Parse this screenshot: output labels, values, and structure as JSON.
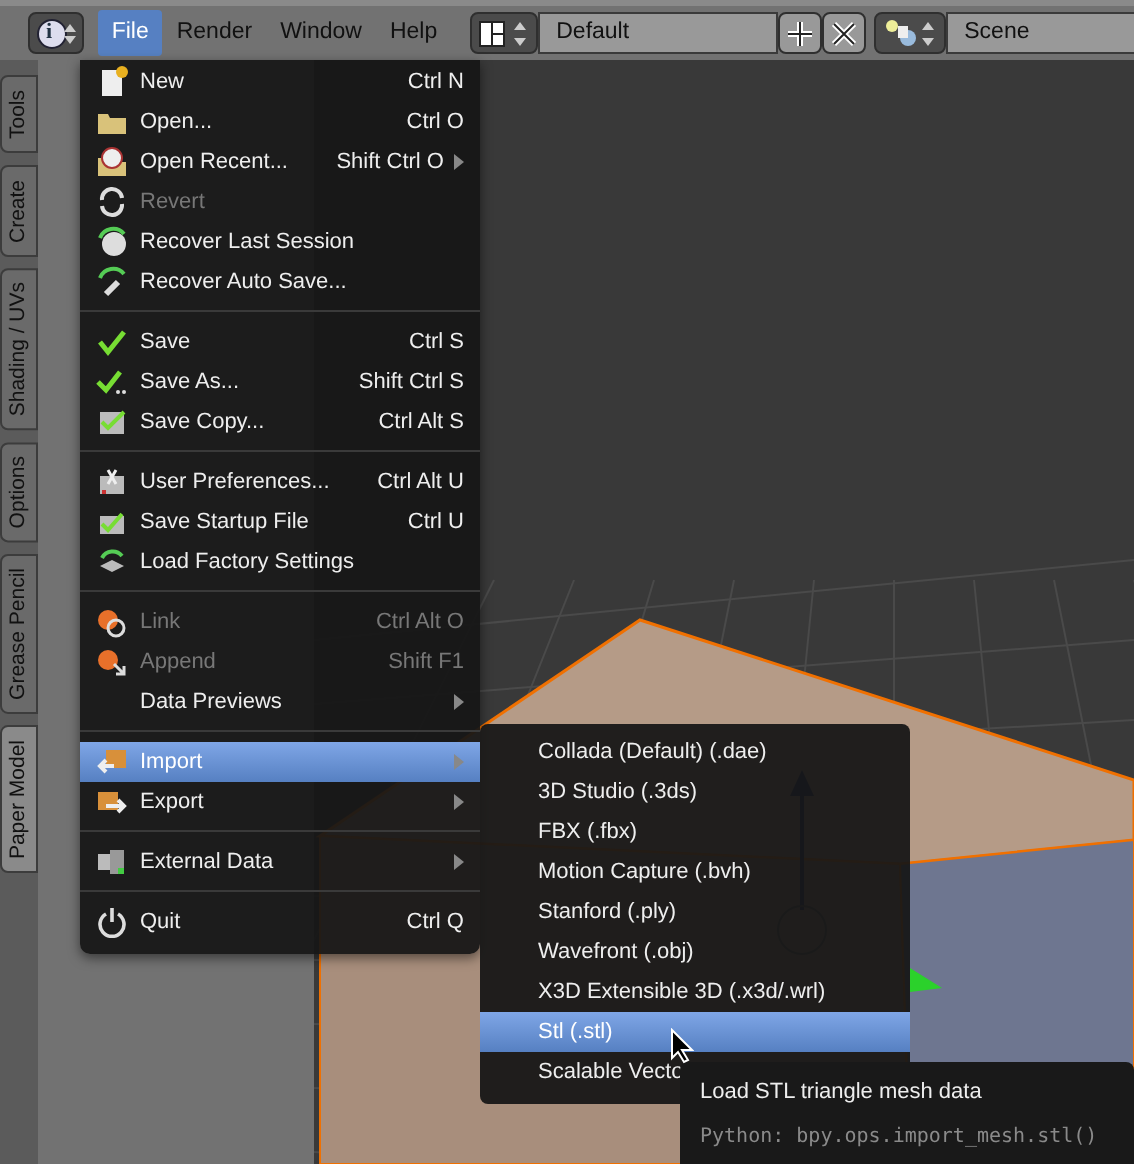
{
  "header": {
    "editor_button": "i",
    "menus": [
      {
        "label": "File",
        "selected": true
      },
      {
        "label": "Render",
        "selected": false
      },
      {
        "label": "Window",
        "selected": false
      },
      {
        "label": "Help",
        "selected": false
      }
    ],
    "layout": "Default",
    "scene": "Scene"
  },
  "tool_tabs": [
    {
      "label": "Tools",
      "selected": false
    },
    {
      "label": "Create",
      "selected": false
    },
    {
      "label": "Shading / UVs",
      "selected": false
    },
    {
      "label": "Options",
      "selected": false
    },
    {
      "label": "Grease Pencil",
      "selected": false
    },
    {
      "label": "Paper Model",
      "selected": true
    }
  ],
  "file_menu": {
    "sections": [
      [
        {
          "label": "New",
          "shortcut": "Ctrl N",
          "disabled": false,
          "submenu": false,
          "selected": false
        },
        {
          "label": "Open...",
          "shortcut": "Ctrl O",
          "disabled": false,
          "submenu": false,
          "selected": false
        },
        {
          "label": "Open Recent...",
          "shortcut": "Shift Ctrl O",
          "disabled": false,
          "submenu": true,
          "selected": false
        },
        {
          "label": "Revert",
          "disabled": true,
          "submenu": false,
          "selected": false
        },
        {
          "label": "Recover Last Session",
          "disabled": false,
          "submenu": false,
          "selected": false
        },
        {
          "label": "Recover Auto Save...",
          "disabled": false,
          "submenu": false,
          "selected": false
        }
      ],
      [
        {
          "label": "Save",
          "shortcut": "Ctrl S",
          "disabled": false,
          "submenu": false,
          "selected": false
        },
        {
          "label": "Save As...",
          "shortcut": "Shift Ctrl S",
          "disabled": false,
          "submenu": false,
          "selected": false
        },
        {
          "label": "Save Copy...",
          "shortcut": "Ctrl Alt S",
          "disabled": false,
          "submenu": false,
          "selected": false
        }
      ],
      [
        {
          "label": "User Preferences...",
          "shortcut": "Ctrl Alt U",
          "disabled": false,
          "submenu": false,
          "selected": false
        },
        {
          "label": "Save Startup File",
          "shortcut": "Ctrl U",
          "disabled": false,
          "submenu": false,
          "selected": false
        },
        {
          "label": "Load Factory Settings",
          "disabled": false,
          "submenu": false,
          "selected": false
        }
      ],
      [
        {
          "label": "Link",
          "shortcut": "Ctrl Alt O",
          "disabled": true,
          "submenu": false,
          "selected": false
        },
        {
          "label": "Append",
          "shortcut": "Shift F1",
          "disabled": true,
          "submenu": false,
          "selected": false
        },
        {
          "label": "Data Previews",
          "disabled": false,
          "submenu": true,
          "selected": false
        }
      ],
      [
        {
          "label": "Import",
          "disabled": false,
          "submenu": true,
          "selected": true
        },
        {
          "label": "Export",
          "disabled": false,
          "submenu": true,
          "selected": false
        }
      ],
      [
        {
          "label": "External Data",
          "disabled": false,
          "submenu": true,
          "selected": false
        }
      ],
      [
        {
          "label": "Quit",
          "shortcut": "Ctrl Q",
          "disabled": false,
          "submenu": false,
          "selected": false
        }
      ]
    ]
  },
  "import_menu": {
    "items": [
      {
        "label": "Collada (Default) (.dae)",
        "selected": false
      },
      {
        "label": "3D Studio (.3ds)",
        "selected": false
      },
      {
        "label": "FBX (.fbx)",
        "selected": false
      },
      {
        "label": "Motion Capture (.bvh)",
        "selected": false
      },
      {
        "label": "Stanford (.ply)",
        "selected": false
      },
      {
        "label": "Wavefront (.obj)",
        "selected": false
      },
      {
        "label": "X3D Extensible 3D (.x3d/.wrl)",
        "selected": false
      },
      {
        "label": "Stl (.stl)",
        "selected": true
      },
      {
        "label": "Scalable Vecto",
        "selected": false
      }
    ]
  },
  "tooltip": {
    "title": "Load STL triangle mesh data",
    "python": "Python: bpy.ops.import_mesh.stl()"
  }
}
